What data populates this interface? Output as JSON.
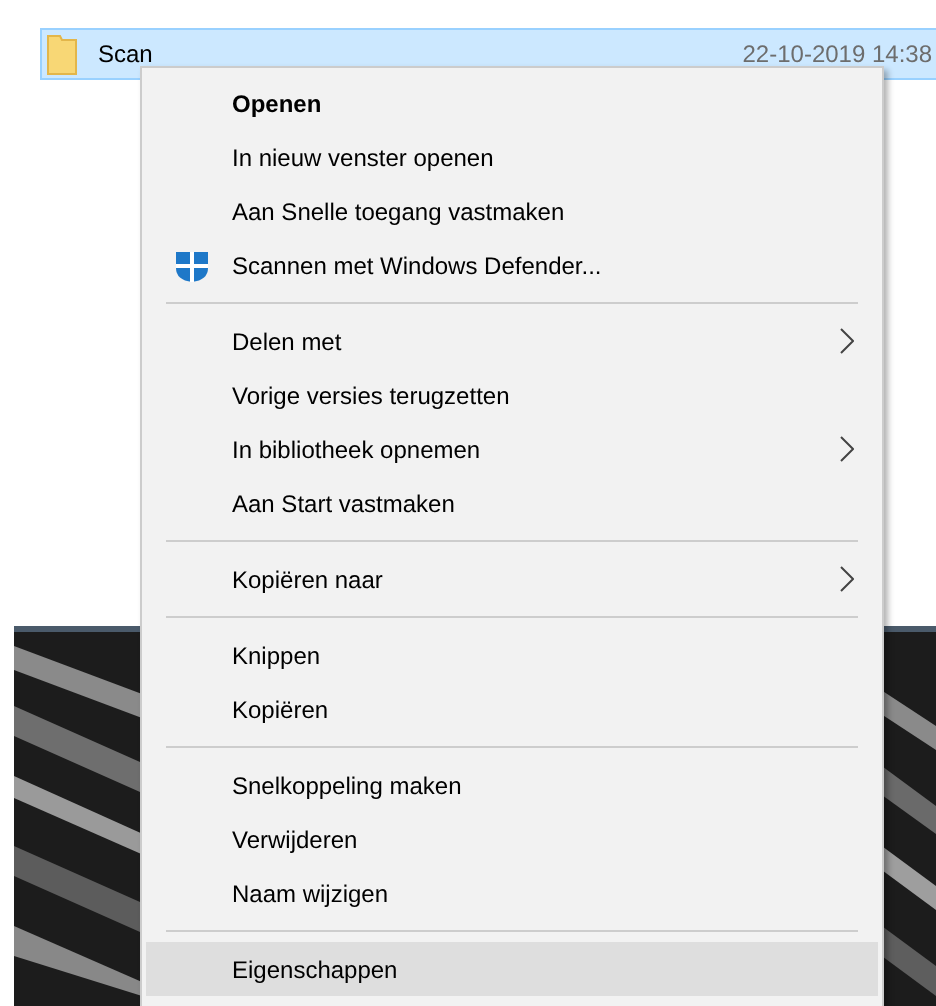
{
  "file_row": {
    "name": "Scan",
    "date": "22-10-2019 14:38",
    "selected": true
  },
  "context_menu": {
    "items": [
      {
        "kind": "item",
        "label": "Openen",
        "default": true,
        "icon": false,
        "submenu": false,
        "highlighted": false
      },
      {
        "kind": "item",
        "label": "In nieuw venster openen",
        "default": false,
        "icon": false,
        "submenu": false,
        "highlighted": false
      },
      {
        "kind": "item",
        "label": "Aan Snelle toegang vastmaken",
        "default": false,
        "icon": false,
        "submenu": false,
        "highlighted": false
      },
      {
        "kind": "item",
        "label": "Scannen met Windows Defender...",
        "default": false,
        "icon": true,
        "submenu": false,
        "highlighted": false
      },
      {
        "kind": "separator"
      },
      {
        "kind": "item",
        "label": "Delen met",
        "default": false,
        "icon": false,
        "submenu": true,
        "highlighted": false
      },
      {
        "kind": "item",
        "label": "Vorige versies terugzetten",
        "default": false,
        "icon": false,
        "submenu": false,
        "highlighted": false
      },
      {
        "kind": "item",
        "label": "In bibliotheek opnemen",
        "default": false,
        "icon": false,
        "submenu": true,
        "highlighted": false
      },
      {
        "kind": "item",
        "label": "Aan Start vastmaken",
        "default": false,
        "icon": false,
        "submenu": false,
        "highlighted": false
      },
      {
        "kind": "separator"
      },
      {
        "kind": "item",
        "label": "Kopiëren naar",
        "default": false,
        "icon": false,
        "submenu": true,
        "highlighted": false
      },
      {
        "kind": "separator"
      },
      {
        "kind": "item",
        "label": "Knippen",
        "default": false,
        "icon": false,
        "submenu": false,
        "highlighted": false
      },
      {
        "kind": "item",
        "label": "Kopiëren",
        "default": false,
        "icon": false,
        "submenu": false,
        "highlighted": false
      },
      {
        "kind": "separator"
      },
      {
        "kind": "item",
        "label": "Snelkoppeling maken",
        "default": false,
        "icon": false,
        "submenu": false,
        "highlighted": false
      },
      {
        "kind": "item",
        "label": "Verwijderen",
        "default": false,
        "icon": false,
        "submenu": false,
        "highlighted": false
      },
      {
        "kind": "item",
        "label": "Naam wijzigen",
        "default": false,
        "icon": false,
        "submenu": false,
        "highlighted": false
      },
      {
        "kind": "separator"
      },
      {
        "kind": "item",
        "label": "Eigenschappen",
        "default": false,
        "icon": false,
        "submenu": false,
        "highlighted": true
      }
    ]
  }
}
